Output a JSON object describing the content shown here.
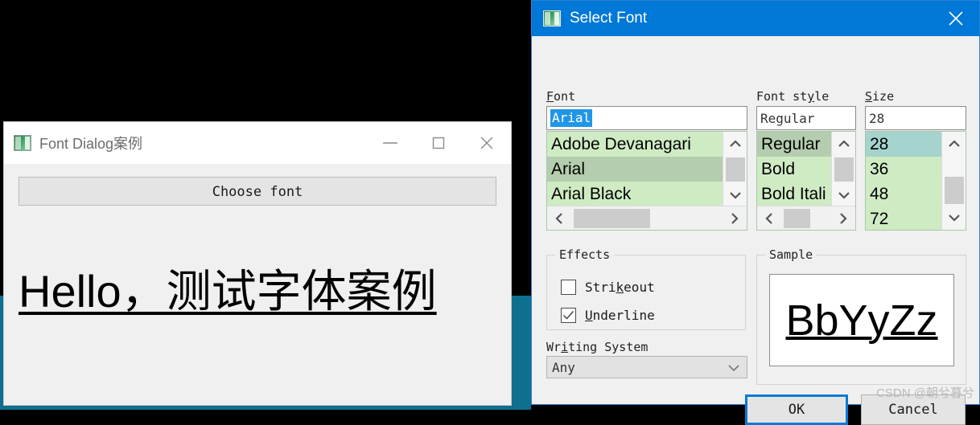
{
  "app_window": {
    "title": "Font Dialog案例",
    "icon": "app-window-icon",
    "minimize": "minimize-icon",
    "maximize": "maximize-icon",
    "close": "close-icon",
    "choose_font_button": "Choose font",
    "display_text": "Hello，测试字体案例"
  },
  "dialog": {
    "title": "Select Font",
    "icon": "dialog-window-icon",
    "close": "close-icon",
    "font": {
      "label": "Font",
      "mnemonic": "F",
      "value": "Arial",
      "items": [
        "Adobe Devanagari",
        "Arial",
        "Arial Black"
      ],
      "selected": "Arial"
    },
    "font_style": {
      "label_pre": "Font st",
      "label_mnemonic": "y",
      "label_post": "le",
      "label": "Font style",
      "value": "Regular",
      "items": [
        "Regular",
        "Bold",
        "Bold Itali"
      ],
      "selected": "Regular"
    },
    "size": {
      "label": "Size",
      "mnemonic": "S",
      "label_rest": "ize",
      "value": "28",
      "items": [
        "28",
        "36",
        "48",
        "72"
      ],
      "selected": "28"
    },
    "effects": {
      "label": "Effects",
      "strikeout": {
        "label_pre": "Stri",
        "label_mnemonic": "k",
        "label_post": "eout",
        "label": "Strikeout",
        "checked": false
      },
      "underline": {
        "label_mnemonic": "U",
        "label_post": "nderline",
        "label": "Underline",
        "checked": true
      }
    },
    "writing_system": {
      "label_pre": "Wr",
      "label_mnemonic": "i",
      "label_post": "ting System",
      "label": "Writing System",
      "value": "Any"
    },
    "sample": {
      "label": "Sample",
      "text": "BbYyZz"
    },
    "buttons": {
      "ok": "OK",
      "cancel": "Cancel"
    }
  },
  "watermark": "CSDN @朝兮暮兮",
  "colors": {
    "dialog_titlebar": "#0078d7",
    "list_background": "#cfebc4",
    "list_selected_green": "#b4cdae",
    "list_selected_teal": "#a5d3cd",
    "text_selection_blue": "#2196e8",
    "focus_border": "#0a7ad4",
    "desktop_band": "#0e6f8e"
  }
}
